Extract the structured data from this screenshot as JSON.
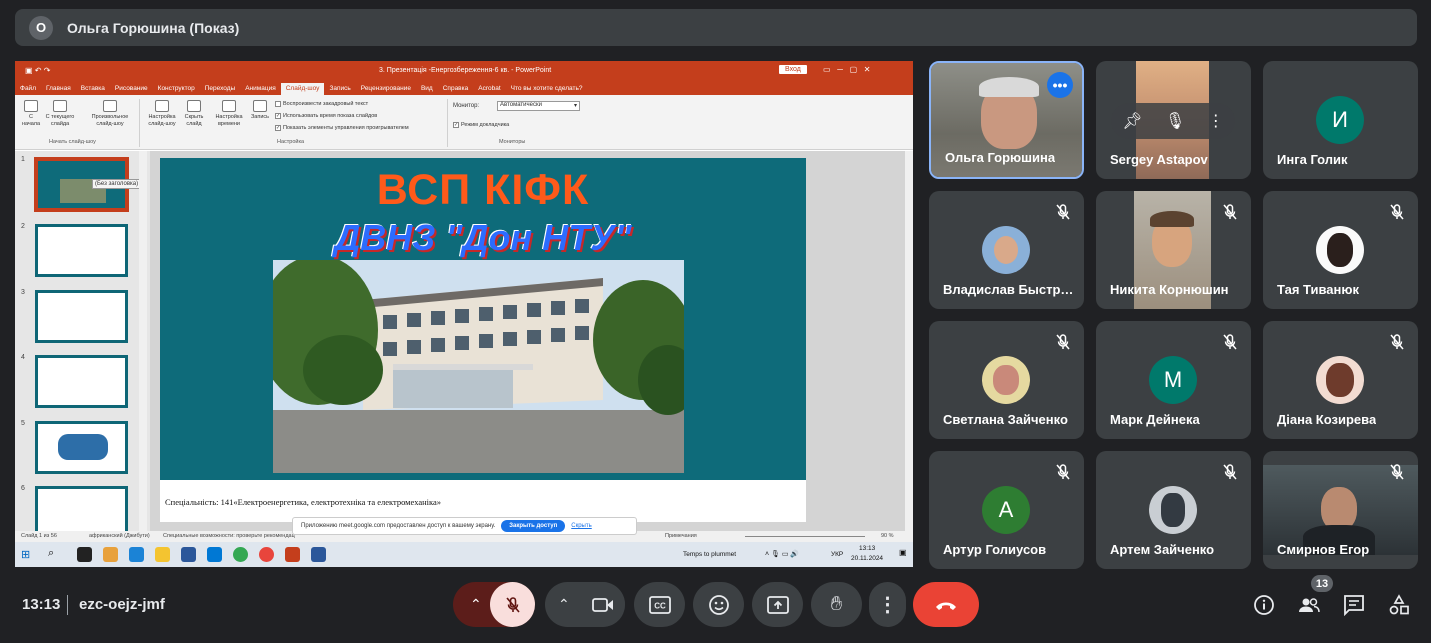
{
  "presenter_bar": {
    "avatar_letter": "О",
    "title": "Ольга Горюшина (Показ)"
  },
  "ppt": {
    "window_title": "3. Презентація -Енергозбереження-6 кв. - PowerPoint",
    "signin": "Вход",
    "tabs": [
      "Файл",
      "Главная",
      "Вставка",
      "Рисование",
      "Конструктор",
      "Переходы",
      "Анимация",
      "Слайд-шоу",
      "Запись",
      "Рецензирование",
      "Вид",
      "Справка",
      "Acrobat",
      "Что вы хотите сделать?"
    ],
    "active_tab": "Слайд-шоу",
    "ribbon": {
      "from_start": "С начала",
      "from_current": "С текущего слайда",
      "custom": "Произвольное слайд-шоу",
      "group_start": "Начать слайд-шоу",
      "setup": "Настройка слайд-шоу",
      "hide": "Скрыть слайд",
      "rehearse": "Настройка времени",
      "record": "Запись",
      "chk_narration": "Воспроизвести закадровый текст",
      "chk_timings": "Использовать время показа слайдов",
      "chk_controls": "Показать элементы управления проигрывателем",
      "group_setup": "Настройка",
      "monitor_label": "Монитор:",
      "monitor_value": "Автоматически",
      "presenter_view": "Режим докладчика",
      "group_monitors": "Мониторы"
    },
    "thumbnails": [
      "1",
      "2",
      "3",
      "4",
      "5",
      "6"
    ],
    "tooltip": "(Без заголовка)",
    "slide": {
      "title1": "ВСП КІФК",
      "title2": "ДВНЗ \"Дон НТУ\"",
      "specialty": "Спеціальність:  141«Електроенергетика, електротехніка та електромеханіка»"
    },
    "status": {
      "slide_count": "Слайд 1 из 56",
      "language": "африканский (Джибути)",
      "accessibility": "Специальные возможности: проверьте рекомендации",
      "notes": "Примечания",
      "zoom": "90 %"
    },
    "share_bar": {
      "text": "Приложению meet.google.com предоставлен доступ к вашему экрану.",
      "stop": "Закрыть доступ",
      "hide": "Скрыть"
    },
    "taskbar": {
      "weather": "Temps to plummet",
      "lang": "УКР",
      "time": "13:13",
      "date": "20.11.2024"
    }
  },
  "participants": [
    {
      "name": "Ольга Горюшина",
      "type": "video"
    },
    {
      "name": "Sergey Astapov",
      "type": "video"
    },
    {
      "name": "Инга Голик",
      "type": "letter",
      "letter": "И",
      "color": "#00796b"
    },
    {
      "name": "Владислав Быстр…",
      "type": "photo"
    },
    {
      "name": "Никита Корнюшин",
      "type": "video"
    },
    {
      "name": "Тая Тиванюк",
      "type": "photo"
    },
    {
      "name": "Светлана Зайченко",
      "type": "photo"
    },
    {
      "name": "Марк Дейнека",
      "type": "letter",
      "letter": "М",
      "color": "#00796b"
    },
    {
      "name": "Діана Козирева",
      "type": "photo"
    },
    {
      "name": "Артур Голиусов",
      "type": "letter",
      "letter": "А",
      "color": "#2e7d32"
    },
    {
      "name": "Артем Зайченко",
      "type": "photo"
    },
    {
      "name": "Смирнов Егор",
      "type": "video"
    }
  ],
  "meeting": {
    "time": "13:13",
    "code": "ezc-oejz-jmf",
    "people_count": "13"
  },
  "colors": {
    "leave": "#ea4335",
    "mic_off_bg": "#f9dedc",
    "active_border": "#8ab4f8"
  }
}
